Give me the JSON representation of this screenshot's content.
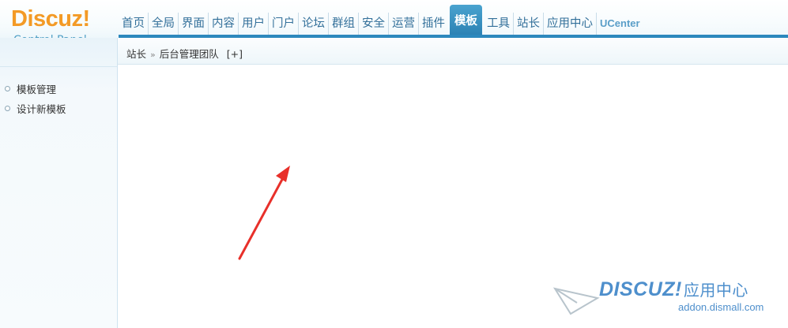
{
  "logo": {
    "main": "Discuz!",
    "sub": "Control Panel"
  },
  "topnav": {
    "items": [
      {
        "label": "首页",
        "active": false
      },
      {
        "label": "全局",
        "active": false
      },
      {
        "label": "界面",
        "active": false
      },
      {
        "label": "内容",
        "active": false
      },
      {
        "label": "用户",
        "active": false
      },
      {
        "label": "门户",
        "active": false
      },
      {
        "label": "论坛",
        "active": false
      },
      {
        "label": "群组",
        "active": false
      },
      {
        "label": "安全",
        "active": false
      },
      {
        "label": "运营",
        "active": false
      },
      {
        "label": "插件",
        "active": false
      },
      {
        "label": "模板",
        "active": true
      },
      {
        "label": "工具",
        "active": false
      },
      {
        "label": "站长",
        "active": false
      },
      {
        "label": "应用中心",
        "active": false
      },
      {
        "label": "UCenter",
        "active": false
      }
    ]
  },
  "breadcrumb": {
    "root": "站长",
    "separator": "»",
    "current": "后台管理团队",
    "add_label": "[+]"
  },
  "sidebar": {
    "items": [
      {
        "label": "模板管理"
      },
      {
        "label": "设计新模板"
      }
    ]
  },
  "watermark": {
    "brand": "DISCUZ!",
    "brand_cn": "应用中心",
    "url": "addon.dismall.com"
  },
  "colors": {
    "logo": "#f39a26",
    "nav_text": "#33709a",
    "nav_active": "#2c82b4",
    "arrow": "#e8302a",
    "watermark": "#4e8fcc"
  }
}
